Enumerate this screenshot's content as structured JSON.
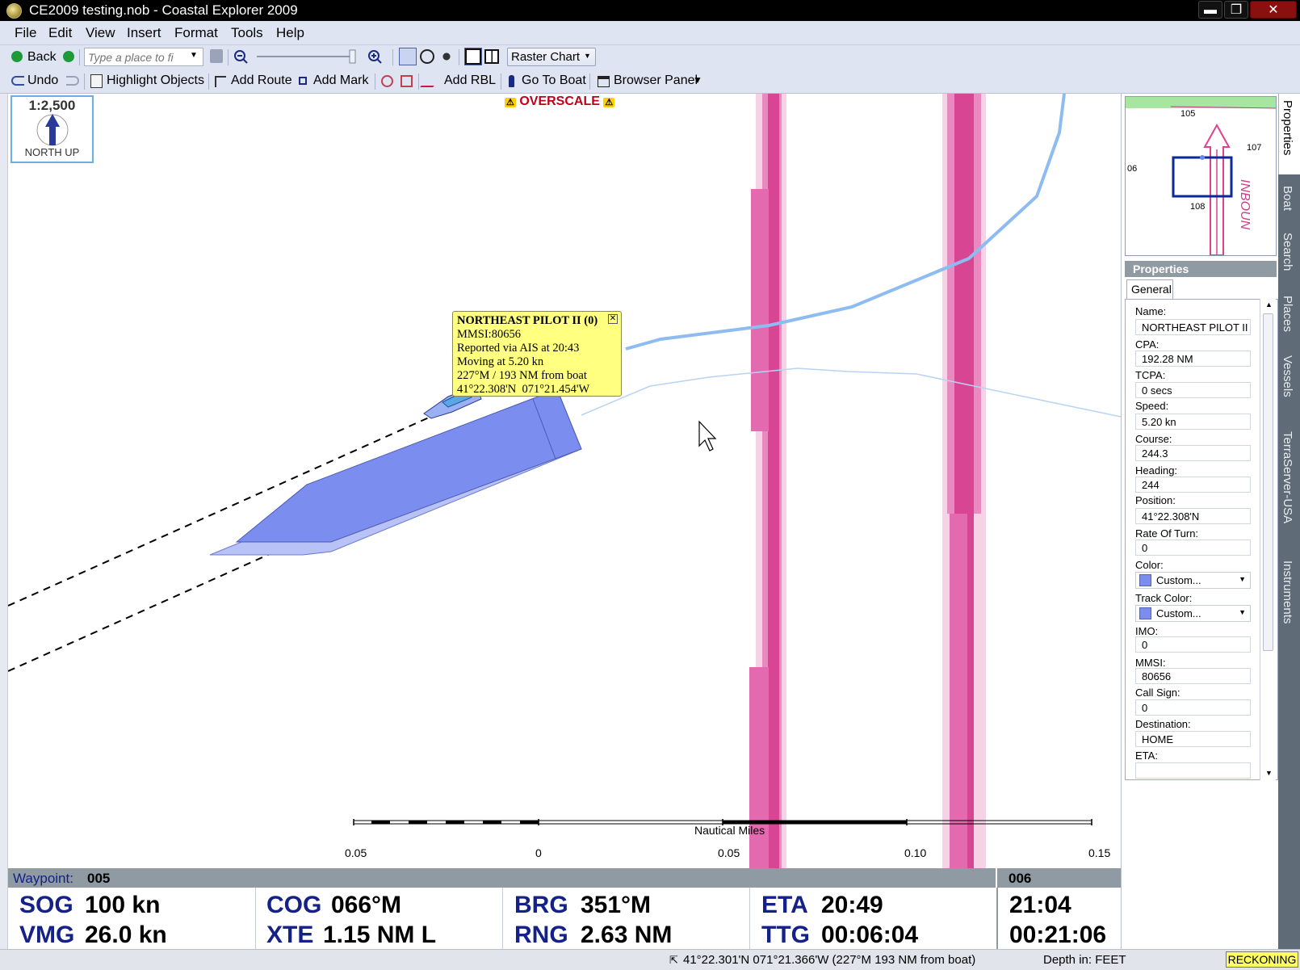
{
  "window": {
    "title": "CE2009 testing.nob - Coastal Explorer 2009",
    "minimize": "▬",
    "restore": "❐",
    "close": "✕"
  },
  "menu": [
    "File",
    "Edit",
    "View",
    "Insert",
    "Format",
    "Tools",
    "Help"
  ],
  "toolbar1": {
    "back_label": "Back",
    "search_placeholder": "Type a place to fi",
    "chart_type": "Raster Chart"
  },
  "toolbar2": {
    "undo": "Undo",
    "highlight_objects": "Highlight Objects",
    "add_route": "Add Route",
    "add_mark": "Add Mark",
    "add_rbl": "Add RBL",
    "go_to_boat": "Go To Boat",
    "browser_panel": "Browser Panel"
  },
  "chart": {
    "scale": "1:2,500",
    "orientation": "NORTH UP",
    "overscale": "OVERSCALE",
    "scalebar_title": "Nautical Miles",
    "scalebar_labels": [
      "0.05",
      "0",
      "0.05",
      "0.10",
      "0.15"
    ]
  },
  "popup": {
    "title": "NORTHEAST PILOT II (0)",
    "lines": [
      "MMSI:80656",
      "Reported via AIS at 20:43",
      "Moving at 5.20 kn",
      "227°M / 193 NM from boat",
      "41°22.308'N  071°21.454'W"
    ]
  },
  "minimap": {
    "labels": [
      "105",
      "107",
      "06",
      "108",
      "INBOUN"
    ]
  },
  "properties": {
    "header": "Properties",
    "tab": "General",
    "fields": [
      {
        "label": "Name:",
        "value": "NORTHEAST PILOT II"
      },
      {
        "label": "CPA:",
        "value": "192.28 NM"
      },
      {
        "label": "TCPA:",
        "value": "0 secs"
      },
      {
        "label": "Speed:",
        "value": "5.20 kn"
      },
      {
        "label": "Course:",
        "value": "244.3"
      },
      {
        "label": "Heading:",
        "value": "244"
      },
      {
        "label": "Position:",
        "value": "41°22.308'N"
      },
      {
        "label": "Rate Of Turn:",
        "value": "0"
      },
      {
        "label": "Color:",
        "value": "Custom..."
      },
      {
        "label": "Track Color:",
        "value": "Custom..."
      },
      {
        "label": "IMO:",
        "value": "0"
      },
      {
        "label": "MMSI:",
        "value": "80656"
      },
      {
        "label": "Call Sign:",
        "value": "0"
      },
      {
        "label": "Destination:",
        "value": "HOME"
      },
      {
        "label": "ETA:",
        "value": ""
      }
    ]
  },
  "side_tabs": [
    "Properties",
    "Boat",
    "Search",
    "Places",
    "Vessels",
    "TerraServer-USA",
    "Instruments"
  ],
  "waypoint": {
    "label": "Waypoint:",
    "current": "005",
    "next": "006"
  },
  "instruments": {
    "sog": {
      "label": "SOG",
      "value": "100 kn"
    },
    "vmg": {
      "label": "VMG",
      "value": "26.0 kn"
    },
    "cog": {
      "label": "COG",
      "value": "066°M"
    },
    "xte": {
      "label": "XTE",
      "value": "1.15 NM L"
    },
    "brg": {
      "label": "BRG",
      "value": "351°M"
    },
    "rng": {
      "label": "RNG",
      "value": "2.63 NM"
    },
    "eta": {
      "label": "ETA",
      "value": "20:49"
    },
    "ttg": {
      "label": "TTG",
      "value": "00:06:04"
    },
    "next_eta": "21:04",
    "next_ttg": "00:21:06"
  },
  "status": {
    "cursor_position": "41°22.301'N  071°21.366'W  (227°M 193 NM from boat)",
    "depth": "Depth in: FEET",
    "mode": "RECKONING"
  },
  "colors": {
    "chrome": "#dfe4f2",
    "instrument_label": "#132188",
    "vessel_fill": "#7b8ef0",
    "channel_magenta": "#d84592",
    "track_blue": "#8cbcf0"
  }
}
